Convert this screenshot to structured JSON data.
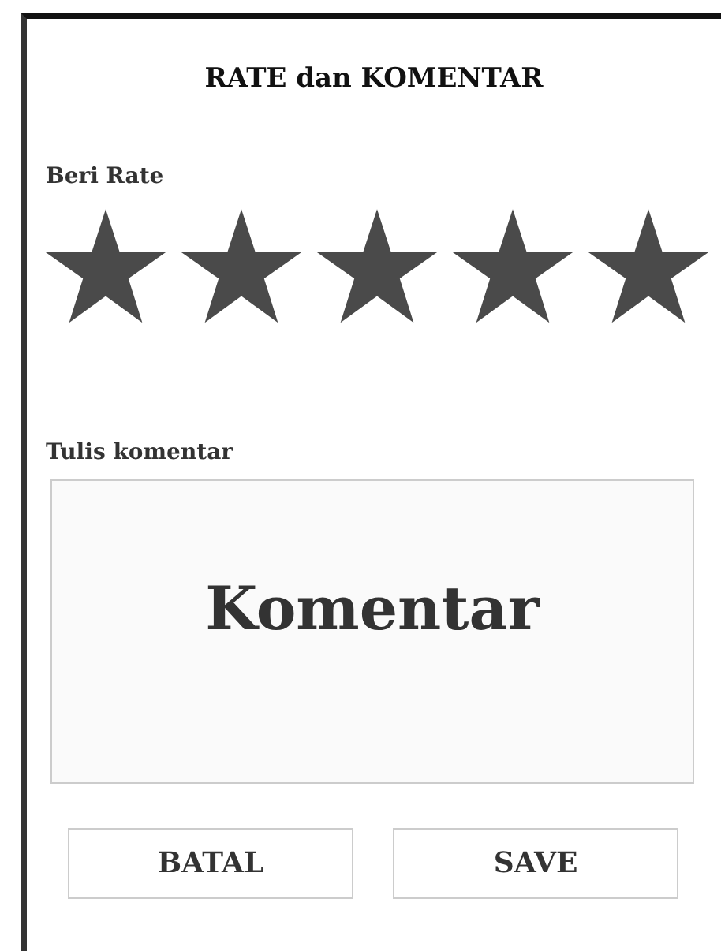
{
  "title": "RATE dan KOMENTAR",
  "rating": {
    "label": "Beri Rate",
    "stars": 5
  },
  "comment": {
    "label": "Tulis komentar",
    "placeholder": "Komentar"
  },
  "buttons": [
    {
      "label": "BATAL"
    },
    {
      "label": "SAVE"
    }
  ]
}
